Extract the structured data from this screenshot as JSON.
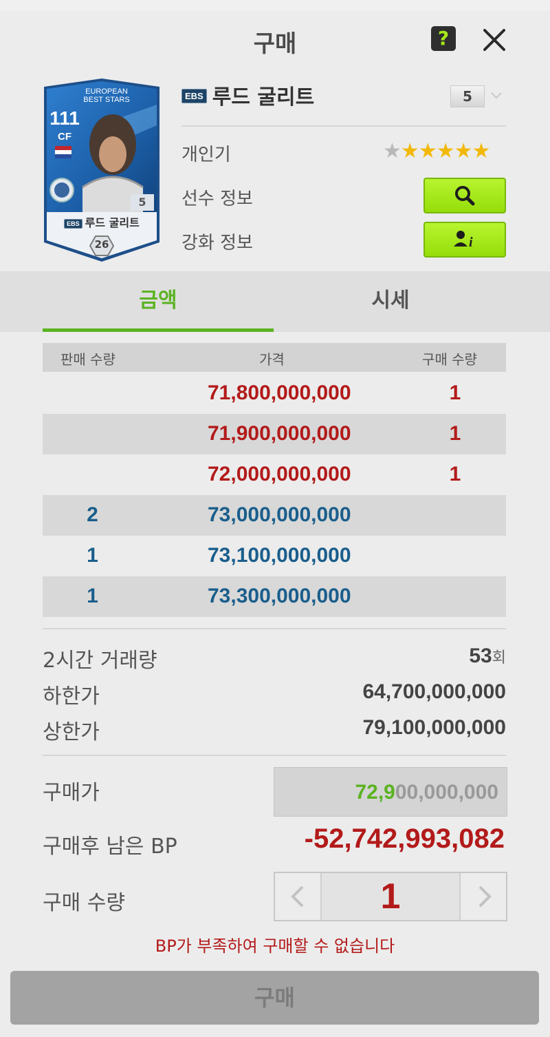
{
  "dialog": {
    "title": "구매",
    "help_label": "?",
    "close_icon": "close-icon"
  },
  "card": {
    "ovr": "111",
    "position": "CF",
    "series": "EUROPEAN BEST STARS",
    "season_badge": "EBS",
    "level": "5",
    "name": "루드 굴리트",
    "bp_label": "26"
  },
  "player": {
    "season_badge": "EBS",
    "name": "루드 굴리트",
    "level": "5"
  },
  "info": {
    "popularity_label": "개인기",
    "stars_filled": 5,
    "stars_total": 6,
    "player_info_label": "선수 정보",
    "enhance_info_label": "강화 정보"
  },
  "tabs": [
    {
      "label": "금액",
      "active": true
    },
    {
      "label": "시세",
      "active": false
    }
  ],
  "table": {
    "headers": [
      "판매 수량",
      "가격",
      "구매 수량"
    ],
    "rows": [
      {
        "sell": "",
        "price": "71,800,000,000",
        "buy": "1",
        "type": "buy"
      },
      {
        "sell": "",
        "price": "71,900,000,000",
        "buy": "1",
        "type": "buy"
      },
      {
        "sell": "",
        "price": "72,000,000,000",
        "buy": "1",
        "type": "buy"
      },
      {
        "sell": "2",
        "price": "73,000,000,000",
        "buy": "",
        "type": "sell"
      },
      {
        "sell": "1",
        "price": "73,100,000,000",
        "buy": "",
        "type": "sell"
      },
      {
        "sell": "1",
        "price": "73,300,000,000",
        "buy": "",
        "type": "sell"
      }
    ]
  },
  "stats": {
    "volume_label": "2시간 거래량",
    "volume_value": "53",
    "volume_unit": "회",
    "min_label": "하한가",
    "min_value": "64,700,000,000",
    "max_label": "상한가",
    "max_value": "79,100,000,000"
  },
  "purchase": {
    "price_label": "구매가",
    "price_highlight": "72,9",
    "price_rest": "00,000,000",
    "remaining_label": "구매후 남은 BP",
    "remaining_value": "-52,742,993,082",
    "qty_label": "구매 수량",
    "qty_value": "1",
    "warning": "BP가 부족하여 구매할 수 없습니다",
    "buy_label": "구매"
  },
  "colors": {
    "accent_green": "#5bb322",
    "button_green": "#a6ea18",
    "price_red": "#b31a1a",
    "price_blue": "#1a5e8c"
  }
}
